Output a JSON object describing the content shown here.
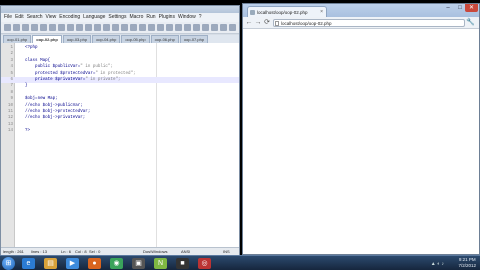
{
  "editor": {
    "menu": [
      "File",
      "Edit",
      "Search",
      "View",
      "Encoding",
      "Language",
      "Settings",
      "Macro",
      "Run",
      "Plugins",
      "Window",
      "?"
    ],
    "tabs": [
      "oop-01.php",
      "oop-02.php",
      "oop-03.php",
      "oop-04.php",
      "oop-05.php",
      "oop-06.php",
      "oop-07.php"
    ],
    "lines": [
      {
        "n": "1",
        "pre": "<?php",
        "str": ""
      },
      {
        "n": "2",
        "pre": "",
        "str": ""
      },
      {
        "n": "3",
        "pre": "class Map{",
        "str": ""
      },
      {
        "n": "4",
        "pre": "    public $publicVar=",
        "str": "\" in public\";"
      },
      {
        "n": "5",
        "pre": "    protected $protectedVar=",
        "str": "\" in protected\";"
      },
      {
        "n": "6",
        "pre": "    private $privateVar=",
        "str": "\" in private\";"
      },
      {
        "n": "7",
        "pre": "}",
        "str": ""
      },
      {
        "n": "8",
        "pre": "",
        "str": ""
      },
      {
        "n": "9",
        "pre": "$obj=new Map;",
        "str": ""
      },
      {
        "n": "10",
        "pre": "//echo $obj->publicVar;",
        "str": ""
      },
      {
        "n": "11",
        "pre": "//echo $obj->protectedVar;",
        "str": ""
      },
      {
        "n": "12",
        "pre": "//echo $obj->privateVar;",
        "str": ""
      },
      {
        "n": "13",
        "pre": "",
        "str": ""
      },
      {
        "n": "14",
        "pre": "?>",
        "str": ""
      }
    ],
    "status": {
      "length": "length : 261",
      "lines": "lines : 13",
      "ln": "Ln : 6",
      "col": "Col : 8",
      "sel": "Sel : 0",
      "eol": "Dos\\Windows",
      "encoding": "ANSI",
      "mode": "INS"
    }
  },
  "browser": {
    "tab_title": "localhost/oop/oop-02.php",
    "url": "localhost/oop/oop-02.php",
    "min": "–",
    "max": "□",
    "close": "✕",
    "tab_close": "×",
    "back": "←",
    "forward": "→",
    "reload": "⟳",
    "wrench": "🔧"
  },
  "taskbar": {
    "start": "⊞",
    "time": "9:21 PM",
    "date": "7/2/2012",
    "icons": [
      {
        "name": "ie-icon",
        "glyph": "e",
        "color": "#2b7bd3"
      },
      {
        "name": "explorer-icon",
        "glyph": "▤",
        "color": "#d8a23a"
      },
      {
        "name": "media-icon",
        "glyph": "▶",
        "color": "#3d8bdc"
      },
      {
        "name": "firefox-icon",
        "glyph": "●",
        "color": "#d9641e"
      },
      {
        "name": "chrome-icon",
        "glyph": "◉",
        "color": "#3aa35b"
      },
      {
        "name": "app-icon",
        "glyph": "▣",
        "color": "#555"
      },
      {
        "name": "notepadpp-icon",
        "glyph": "N",
        "color": "#7fb842"
      },
      {
        "name": "terminal-icon",
        "glyph": "■",
        "color": "#333"
      },
      {
        "name": "recorder-icon",
        "glyph": "◎",
        "color": "#b33"
      }
    ]
  }
}
